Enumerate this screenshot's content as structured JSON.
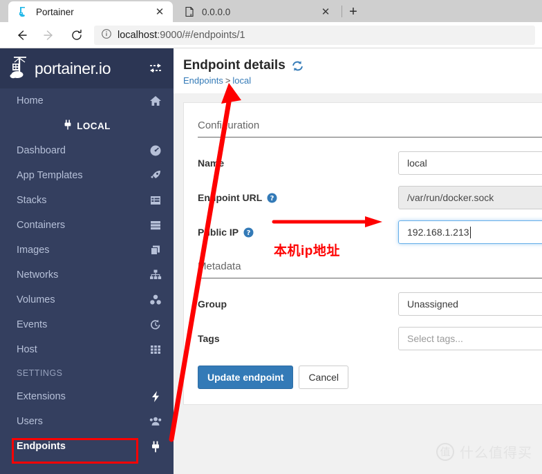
{
  "browser": {
    "tabs": [
      {
        "title": "Portainer",
        "favicon": "portainer-icon",
        "active": true,
        "close_label": "✕"
      },
      {
        "title": "0.0.0.0",
        "favicon": "broken-page-icon",
        "active": false,
        "close_label": "✕"
      }
    ],
    "new_tab_label": "+",
    "nav": {
      "back_label": "←",
      "forward_label": "→",
      "reload_label": "↻",
      "info_icon": "info-circle-icon",
      "url_host": "localhost",
      "url_rest": ":9000/#/endpoints/1"
    }
  },
  "sidebar": {
    "brand": {
      "text": "portainer.io",
      "logo_icon": "portainer-logo-icon",
      "toggle_icon": "collapse-sidebar-icon"
    },
    "home": {
      "label": "Home",
      "icon": "home-icon"
    },
    "local_badge": {
      "label": "LOCAL",
      "icon": "plug-icon"
    },
    "items": [
      {
        "label": "Dashboard",
        "icon": "dashboard-icon"
      },
      {
        "label": "App Templates",
        "icon": "rocket-icon"
      },
      {
        "label": "Stacks",
        "icon": "stacks-icon"
      },
      {
        "label": "Containers",
        "icon": "containers-icon"
      },
      {
        "label": "Images",
        "icon": "images-icon"
      },
      {
        "label": "Networks",
        "icon": "networks-icon"
      },
      {
        "label": "Volumes",
        "icon": "volumes-icon"
      },
      {
        "label": "Events",
        "icon": "events-icon"
      },
      {
        "label": "Host",
        "icon": "host-icon"
      }
    ],
    "settings_section": "SETTINGS",
    "settings_items": [
      {
        "label": "Extensions",
        "icon": "bolt-icon"
      },
      {
        "label": "Users",
        "icon": "users-icon"
      },
      {
        "label": "Endpoints",
        "icon": "plug-icon",
        "current": true
      }
    ]
  },
  "page": {
    "title": "Endpoint details",
    "refresh_icon": "refresh-icon",
    "breadcrumb": {
      "root": "Endpoints",
      "separator": ">",
      "current": "local"
    }
  },
  "form": {
    "configuration_title": "Configuration",
    "name": {
      "label": "Name",
      "value": "local"
    },
    "endpoint_url": {
      "label": "Endpoint URL",
      "value": "/var/run/docker.sock",
      "help_icon": "help-circle-icon"
    },
    "public_ip": {
      "label": "Public IP",
      "value": "192.168.1.213",
      "help_icon": "help-circle-icon"
    },
    "metadata_title": "Metadata",
    "group": {
      "label": "Group",
      "value": "Unassigned"
    },
    "tags": {
      "label": "Tags",
      "placeholder": "Select tags..."
    },
    "submit_label": "Update endpoint",
    "cancel_label": "Cancel"
  },
  "annotations": {
    "chinese_note": "本机ip地址",
    "highlight_color": "#fe0000",
    "arrow_color": "#fe0000"
  },
  "watermark": {
    "mark": "值",
    "text": "什么值得买"
  },
  "colors": {
    "sidebar_bg": "#343f5f",
    "brand_bg": "#2c3654",
    "accent": "#337ab7",
    "page_bg": "#f1f1f1",
    "focus_border": "#66afe9"
  }
}
